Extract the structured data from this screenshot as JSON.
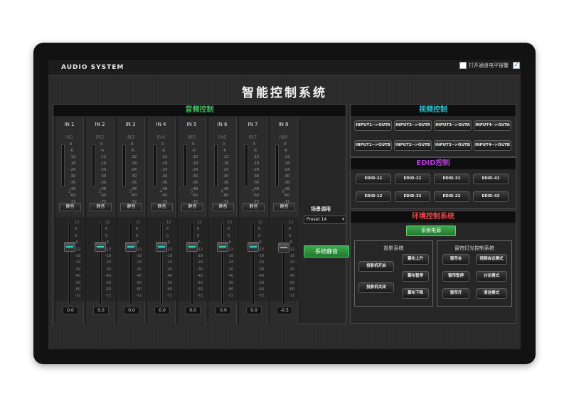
{
  "header": {
    "brand": "AUDIO SYSTEM",
    "alarm_label": "打开通道电平报警",
    "main_checked": "✓"
  },
  "title": "智能控制系统",
  "audio": {
    "heading": "音频控制",
    "scale": [
      "0",
      "-6",
      "-12",
      "-18",
      "-24",
      "-30",
      "-36",
      "-48",
      "-60",
      "-72"
    ],
    "fader_scale": [
      "12",
      "6",
      "0",
      "-6",
      "-12",
      "-18",
      "-24",
      "-30",
      "-40",
      "-50",
      "-60",
      "-72"
    ],
    "channels": [
      {
        "name": "IN 1",
        "sub": "IN1",
        "num": "1",
        "mute": "静音",
        "value": "0.0",
        "level": 0.27
      },
      {
        "name": "IN 2",
        "sub": "IN2",
        "num": "2",
        "mute": "静音",
        "value": "0.0",
        "level": 0.27
      },
      {
        "name": "IN 3",
        "sub": "IN3",
        "num": "3",
        "mute": "静音",
        "value": "0.0",
        "level": 0.27
      },
      {
        "name": "IN 4",
        "sub": "IN4",
        "num": "4",
        "mute": "静音",
        "value": "0.0",
        "level": 0.27
      },
      {
        "name": "IN 5",
        "sub": "IN5",
        "num": "5",
        "mute": "静音",
        "value": "0.0",
        "level": 0.27
      },
      {
        "name": "IN 6",
        "sub": "IN6",
        "num": "6",
        "mute": "静音",
        "value": "0.0",
        "level": 0.27
      },
      {
        "name": "IN 7",
        "sub": "IN7",
        "num": "7",
        "mute": "静音",
        "value": "0.0",
        "level": 0.27
      },
      {
        "name": "IN 8",
        "sub": "IN8",
        "num": "8",
        "mute": "静音",
        "value": "-0.5",
        "level": 0.28
      }
    ],
    "preset_label": "场景调用",
    "preset_value": "Preset 14",
    "system_mute": "系统静音"
  },
  "video": {
    "heading": "视频控制",
    "buttons": [
      "INPUT1-->OUTA",
      "INPUT2-->OUTA",
      "INPUT3-->OUTA",
      "INPUT4-->OUTA",
      "INPUT1-->OUTB",
      "INPUT2-->OUTB",
      "INPUT3-->OUTB",
      "INPUT4-->OUTB"
    ]
  },
  "edid": {
    "heading": "EDID控制",
    "buttons": [
      "EDID-11",
      "EDID-21",
      "EDID-31",
      "EDID-41",
      "EDID-12",
      "EDID-32",
      "EDID-22",
      "EDID-42"
    ]
  },
  "env": {
    "heading": "环境控制系统",
    "power": "系统电源",
    "projection": {
      "title": "投影系统",
      "on": "投影机开启",
      "off": "投影机关闭",
      "up": "幕布上升",
      "stop": "幕布暂停",
      "down": "幕布下降"
    },
    "lighting": {
      "title": "窗帘灯光控制系统",
      "close": "窗帘合",
      "pause": "窗帘暂停",
      "open": "窗帘开",
      "meeting": "视频会议模式",
      "discussion": "讨论模式",
      "clean": "清洁模式"
    }
  }
}
